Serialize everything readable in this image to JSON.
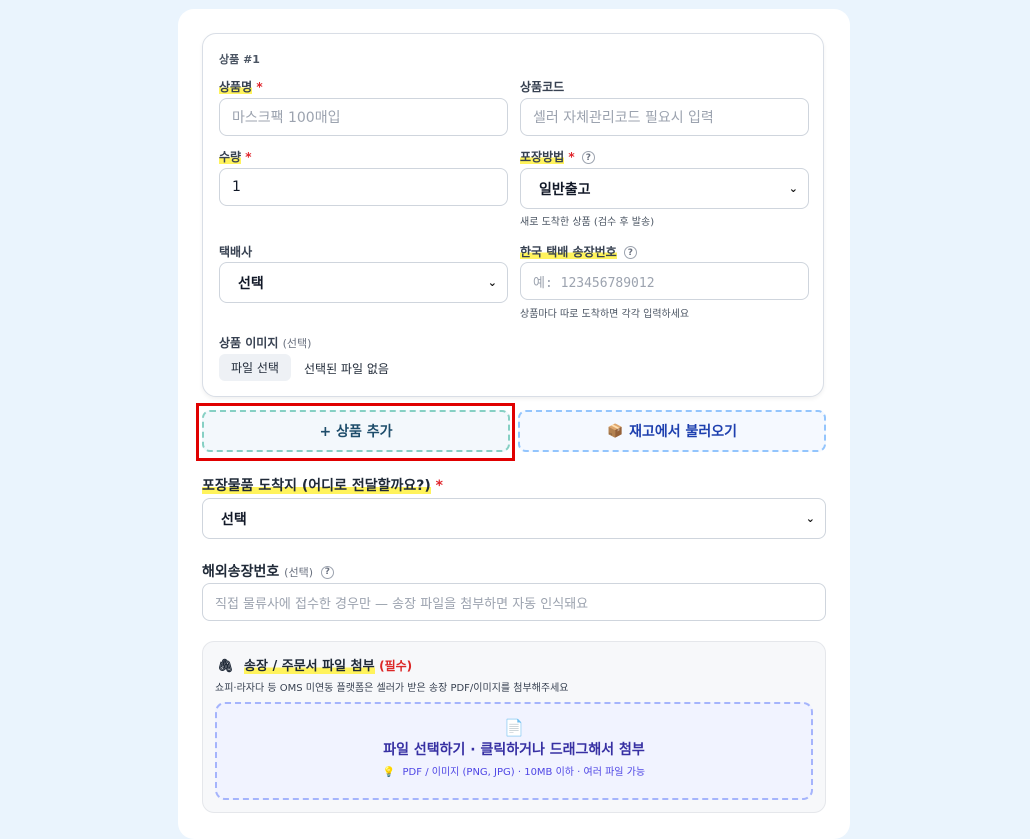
{
  "product": {
    "title": "상품 #1",
    "name_label": "상품명",
    "name_placeholder": "마스크팩 100매입",
    "code_label": "상품코드",
    "code_placeholder": "셀러 자체관리코드 필요시 입력",
    "qty_label": "수량",
    "qty_value": "1",
    "packing_label": "포장방법",
    "packing_value": "일반출고",
    "packing_hint": "새로 도착한 상품 (검수 후 발송)",
    "courier_label": "택배사",
    "courier_value": "선택",
    "tracking_label": "한국 택배 송장번호",
    "tracking_placeholder": "예: 123456789012",
    "tracking_hint": "상품마다 따로 도착하면 각각 입력하세요",
    "image_label": "상품 이미지",
    "image_optional": "(선택)",
    "file_button": "파일 선택",
    "file_status": "선택된 파일 없음"
  },
  "required_mark": "*",
  "help_mark": "?",
  "buttons": {
    "add_product": "+  상품 추가",
    "load_inventory_icon": "📦",
    "load_inventory": "재고에서 불러오기"
  },
  "destination": {
    "label": "포장물품 도착지 (어디로 전달할까요?)",
    "value": "선택"
  },
  "overseas": {
    "label": "해외송장번호",
    "optional": "(선택)",
    "placeholder": "직접 물류사에 접수한 경우만 — 송장 파일을 첨부하면 자동 인식돼요"
  },
  "attachment": {
    "icon": "🖇",
    "title": "송장 / 주문서 파일 첨부",
    "required": "(필수)",
    "desc": "쇼피·라자다 등 OMS 미연동 플랫폼은 셀러가 받은 송장 PDF/이미지를 첨부해주세요",
    "drop_icon": "📄",
    "drop_title": "파일 선택하기 · 클릭하거나 드래그해서 첨부",
    "drop_hint_icon": "💡",
    "drop_hint": "PDF / 이미지 (PNG, JPG) · 10MB 이하 · 여러 파일 가능"
  },
  "chevron": "⌄"
}
